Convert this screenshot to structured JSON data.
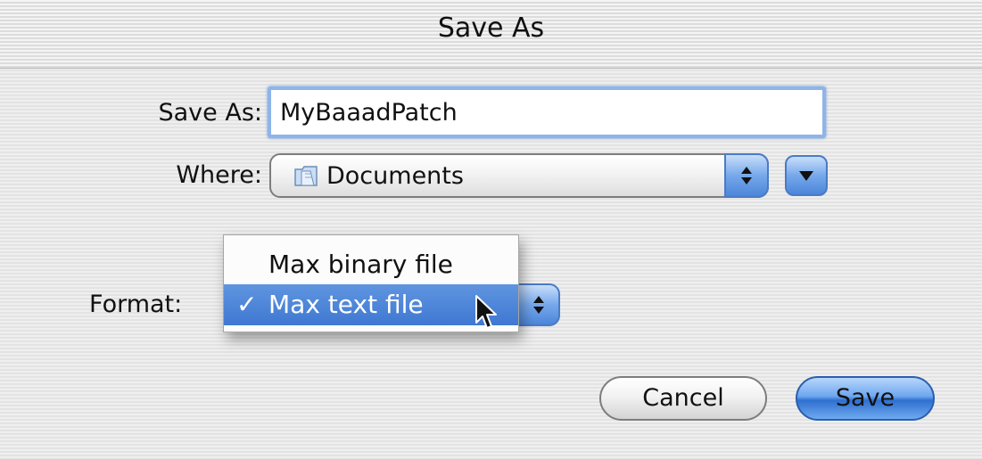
{
  "window": {
    "title": "Save As"
  },
  "save_as": {
    "label": "Save As:",
    "value": "MyBaaadPatch"
  },
  "where": {
    "label": "Where:",
    "selected": "Documents",
    "icon": "folder-icon"
  },
  "format": {
    "label": "Format:",
    "options": [
      {
        "label": "Max binary file",
        "checked": false
      },
      {
        "label": "Max text file",
        "checked": true
      }
    ],
    "check_mark": "✓"
  },
  "buttons": {
    "cancel": "Cancel",
    "save": "Save"
  },
  "colors": {
    "accent": "#3f78d2",
    "field_focus": "#8fb4e8"
  }
}
